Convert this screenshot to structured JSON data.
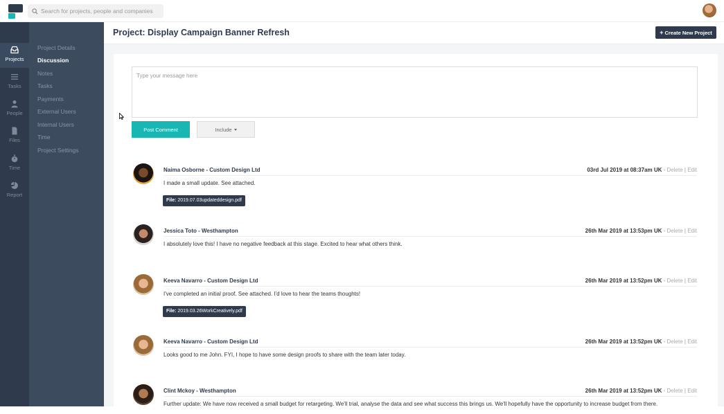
{
  "search": {
    "placeholder": "Search for projects, people and companies"
  },
  "rail": [
    {
      "label": "Projects",
      "icon": "inbox-icon",
      "active": true
    },
    {
      "label": "Tasks",
      "icon": "list-icon"
    },
    {
      "label": "People",
      "icon": "person-icon"
    },
    {
      "label": "Files",
      "icon": "file-icon"
    },
    {
      "label": "Time",
      "icon": "stopwatch-icon"
    },
    {
      "label": "Report",
      "icon": "pie-chart-icon"
    }
  ],
  "subnav": [
    {
      "label": "Project Details"
    },
    {
      "label": "Discussion",
      "active": true
    },
    {
      "label": "Notes"
    },
    {
      "label": "Tasks"
    },
    {
      "label": "Payments"
    },
    {
      "label": "External Users"
    },
    {
      "label": "Internal Users"
    },
    {
      "label": "Time"
    },
    {
      "label": "Project Settings"
    }
  ],
  "header": {
    "title": "Project: Display Campaign Banner Refresh",
    "create_label": "Create New Project"
  },
  "composer": {
    "placeholder": "Type your message here",
    "post_label": "Post Comment",
    "include_label": "Include"
  },
  "comments": [
    {
      "author": "Naima Osborne - Custom Design Ltd",
      "date": "03rd Jul 2019 at 08:37am UK",
      "text": "I made a small update. See attached.",
      "file": "2019.07.03updateddesign.pdf"
    },
    {
      "author": "Jessica Toto - Westhampton",
      "date": "26th Mar 2019 at 13:53pm UK",
      "text": "I absolutely love this! I have no negative feedback at this stage. Excited to hear what others think."
    },
    {
      "author": "Keeva Navarro - Custom Design Ltd",
      "date": "26th Mar 2019 at 13:52pm UK",
      "text": "I've completed an initial proof. See attached. I'd love to hear the teams thoughts!",
      "file": "2019.03.26WorkCreatively.pdf"
    },
    {
      "author": "Keeva Navarro - Custom Design Ltd",
      "date": "26th Mar 2019 at 13:52pm UK",
      "text": "Looks good to me John. FYI, I hope to have some design proofs to share with the team later today."
    },
    {
      "author": "Clint Mckoy - Westhampton",
      "date": "26th Mar 2019 at 13:52pm UK",
      "text": "Further update: We have now received a small budget for retargeting. We'll trial, analyse the data and see what success this brings us. We'll hopefully have the opportunity to increase budget from there."
    }
  ],
  "labels": {
    "delete": "Delete",
    "edit": "Edit",
    "separator": "-",
    "pipe": "|",
    "file_prefix": "File:"
  },
  "colors": {
    "rail": "#2f3b4c",
    "subnav": "#3c4b5e",
    "accent": "#1ab6b3",
    "file_badge": "#2f3b4c"
  }
}
